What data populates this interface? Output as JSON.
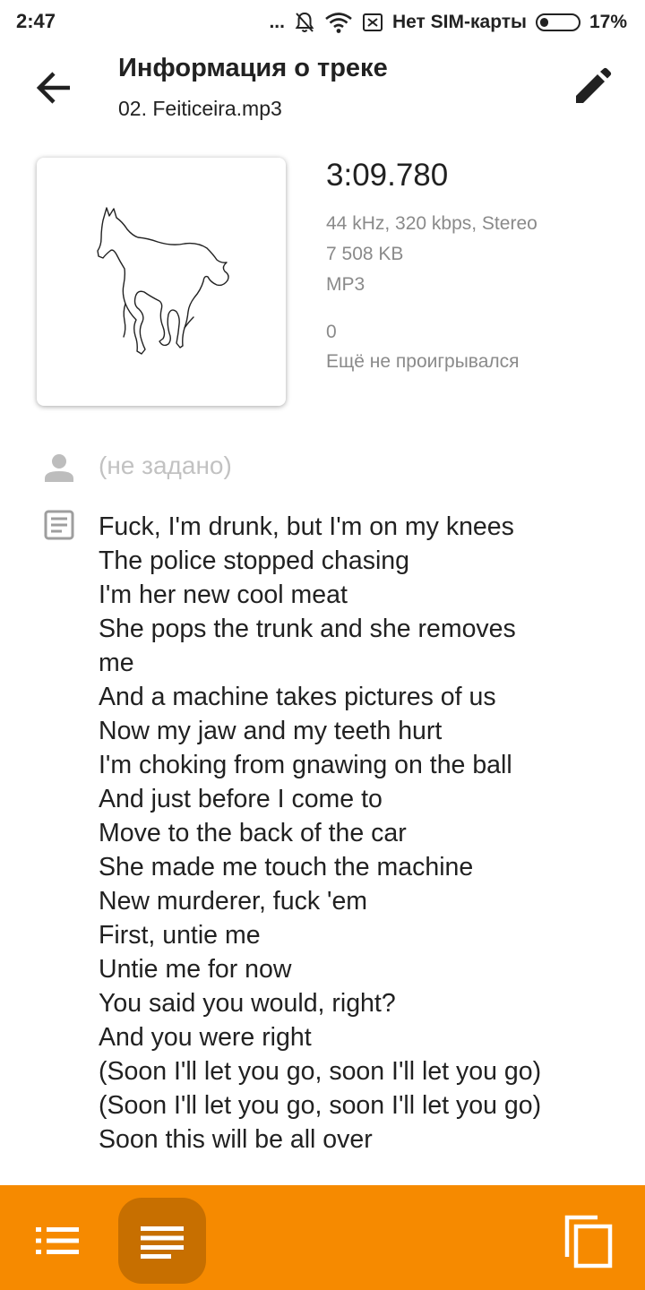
{
  "status_bar": {
    "time": "2:47",
    "dots": "...",
    "carrier": "Нет SIM-карты",
    "battery": "17%"
  },
  "header": {
    "title": "Информация о треке",
    "subtitle": "02. Feiticeira.mp3"
  },
  "track": {
    "duration": "3:09.780",
    "format_details": "44 kHz, 320 kbps, Stereo",
    "size": "7 508 KB",
    "codec": "MP3",
    "play_count": "0",
    "last_played": "Ещё не проигрывался"
  },
  "composer": {
    "placeholder": "(не задано)"
  },
  "lyrics": [
    "Fuck, I'm drunk, but I'm on my knees",
    "The police stopped chasing",
    "I'm her new cool meat",
    "She pops the trunk and she removes",
    "me",
    "And a machine takes pictures of us",
    "Now my jaw and my teeth hurt",
    "I'm choking from gnawing on the ball",
    "And just before I come to",
    "Move to the back of the car",
    "She made me touch the machine",
    "New murderer, fuck 'em",
    "First, untie me",
    "Untie me for now",
    "You said you would, right?",
    "And you were right",
    "(Soon I'll let you go, soon I'll let you go)",
    "(Soon I'll let you go, soon I'll let you go)",
    "Soon this will be all over"
  ],
  "colors": {
    "accent": "#f68a00",
    "accent_dark": "#c76f00",
    "secondary_text": "#8a8a8a",
    "placeholder_text": "#c2c2c2"
  },
  "icons": {
    "back": "arrow-back-icon",
    "edit": "pencil-icon",
    "composer": "person-icon",
    "lyrics": "lyrics-icon",
    "nav_list": "list-icon",
    "nav_lyrics": "lines-icon",
    "nav_copy": "copy-icon"
  }
}
